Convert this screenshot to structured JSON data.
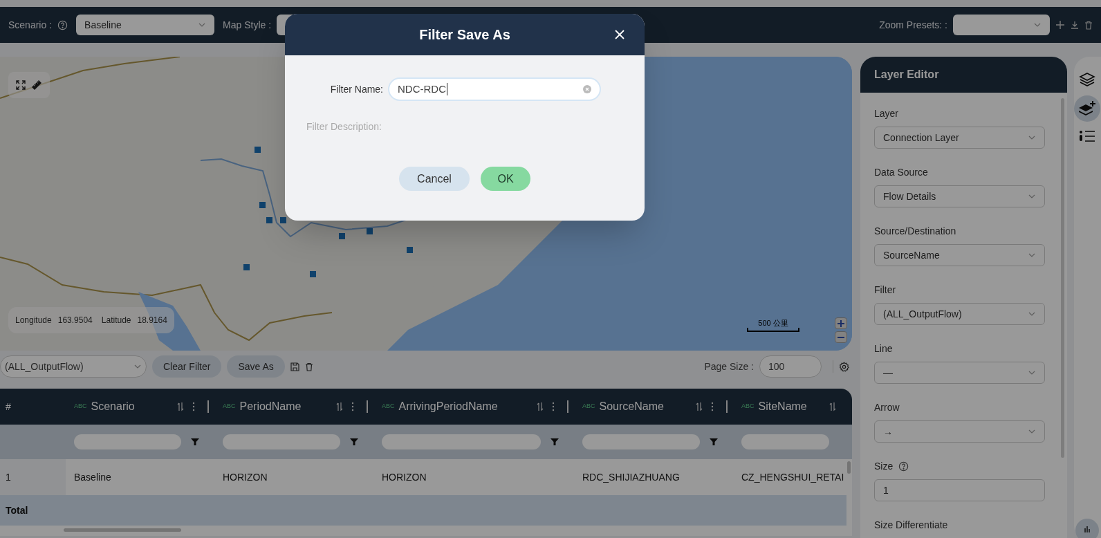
{
  "top_bar": {
    "scenario_label": "Scenario :",
    "scenario_value": "Baseline",
    "map_style_label": "Map Style :",
    "zoom_presets_label": "Zoom Presets: :"
  },
  "map": {
    "longitude_label": "Longitude",
    "longitude": "163.9504",
    "latitude_label": "Latitude",
    "latitude": "18.9164",
    "scale": "500 公里"
  },
  "filter_bar": {
    "filter": "(ALL_OutputFlow)",
    "clear_button": "Clear Filter",
    "save_as_button": "Save As",
    "page_size_label": "Page Size :",
    "page_size": "100"
  },
  "table": {
    "columns": [
      {
        "label": "#"
      },
      {
        "type_tag": "ABC",
        "label": "Scenario"
      },
      {
        "type_tag": "ABC",
        "label": "PeriodName"
      },
      {
        "type_tag": "ABC",
        "label": "ArrivingPeriodName"
      },
      {
        "type_tag": "ABC",
        "label": "SourceName"
      },
      {
        "type_tag": "ABC",
        "label": "SiteName"
      }
    ],
    "rows": [
      {
        "cells": [
          "1",
          "Baseline",
          "HORIZON",
          "HORIZON",
          "RDC_SHIJIAZHUANG",
          "CZ_HENGSHUI_RETAI"
        ]
      }
    ],
    "total_label": "Total"
  },
  "layer_editor": {
    "title": "Layer Editor",
    "fields": [
      {
        "label": "Layer",
        "value": "Connection Layer",
        "kind": "select",
        "help": false
      },
      {
        "label": "Data Source",
        "value": "Flow Details",
        "kind": "select",
        "help": false
      },
      {
        "label": "Source/Destination",
        "value": "SourceName",
        "kind": "select",
        "help": false
      },
      {
        "label": "Filter",
        "value": "(ALL_OutputFlow)",
        "kind": "select",
        "help": false
      },
      {
        "label": "Line",
        "value": "—",
        "kind": "select",
        "help": false
      },
      {
        "label": "Arrow",
        "value": "→",
        "kind": "select",
        "help": false
      },
      {
        "label": "Size",
        "value": "1",
        "kind": "input",
        "help": true
      },
      {
        "label": "Size Differentiate",
        "kind": "label",
        "help": false
      }
    ]
  },
  "dialog": {
    "title": "Filter Save As",
    "name_label": "Filter Name:",
    "name_value": "NDC-RDC",
    "description_label": "Filter Description:",
    "cancel_button": "Cancel",
    "ok_button": "OK"
  }
}
